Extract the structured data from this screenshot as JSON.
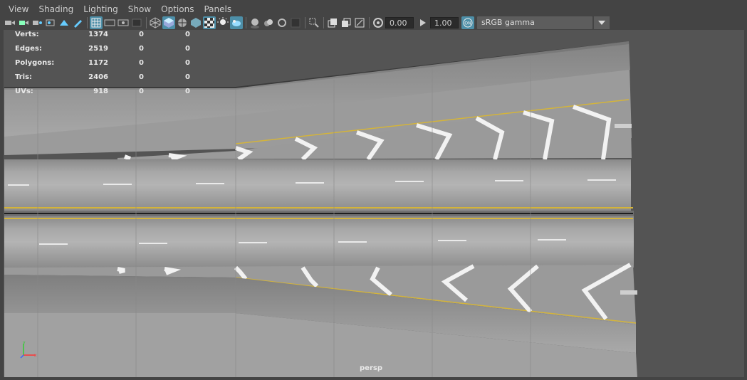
{
  "menubar": {
    "items": [
      {
        "label": "View"
      },
      {
        "label": "Shading"
      },
      {
        "label": "Lighting"
      },
      {
        "label": "Show"
      },
      {
        "label": "Options"
      },
      {
        "label": "Panels"
      }
    ]
  },
  "toolbar": {
    "exposure_value": "0.00",
    "gamma_value": "1.00",
    "color_space": "sRGB gamma",
    "icons": [
      "select-camera-icon",
      "camera-attributes-icon",
      "bookmark-icon",
      "image-plane-icon",
      "2d-pan-zoom-icon",
      "grease-pencil-icon",
      "grid-icon",
      "film-gate-icon",
      "resolution-gate-icon",
      "gate-mask-icon",
      "wireframe-icon",
      "smooth-shade-icon",
      "wireframe-on-shaded-icon",
      "default-material-icon",
      "textured-icon",
      "xray-icon",
      "use-lights-icon",
      "shadows-icon",
      "screen-space-ao-icon",
      "motion-blur-icon",
      "multisample-aa-icon",
      "depth-of-field-icon",
      "isolate-select-icon",
      "xray-joints-icon",
      "xray-active-icon",
      "backface-culling-icon",
      "exposure-icon",
      "gamma-icon",
      "color-management-icon"
    ]
  },
  "hud": {
    "rows": [
      {
        "label": "Verts:",
        "v1": "1374",
        "v2": "0",
        "v3": "0"
      },
      {
        "label": "Edges:",
        "v1": "2519",
        "v2": "0",
        "v3": "0"
      },
      {
        "label": "Polygons:",
        "v1": "1172",
        "v2": "0",
        "v3": "0"
      },
      {
        "label": "Tris:",
        "v1": "2406",
        "v2": "0",
        "v3": "0"
      },
      {
        "label": "UVs:",
        "v1": "918",
        "v2": "0",
        "v3": "0"
      }
    ]
  },
  "viewport": {
    "camera": "persp",
    "axis_colors": {
      "x": "#ff3333",
      "y": "#33cc33",
      "z": "#3366ff"
    }
  },
  "colors": {
    "accent": "#4d8fa8",
    "background": "#444444",
    "viewport_bg": "#545454",
    "road_marking_yellow": "#d4b43a"
  }
}
